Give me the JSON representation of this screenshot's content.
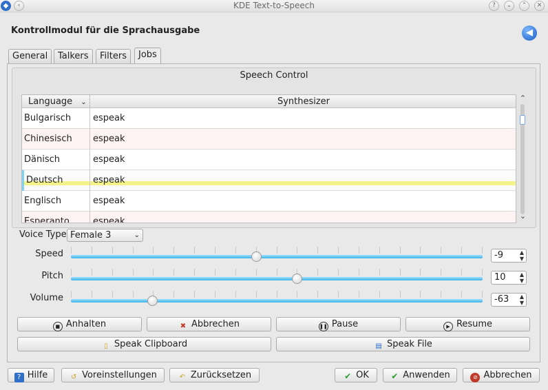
{
  "window": {
    "title": "KDE Text-to-Speech"
  },
  "header": {
    "title": "Kontrollmodul für die Sprachausgabe"
  },
  "tabs": [
    {
      "label": "General"
    },
    {
      "label": "Talkers"
    },
    {
      "label": "Filters"
    },
    {
      "label": "Jobs"
    }
  ],
  "speech_control": {
    "title": "Speech Control",
    "columns": {
      "language": "Language",
      "synthesizer": "Synthesizer"
    },
    "rows": [
      {
        "language": "Bulgarisch",
        "synthesizer": "espeak"
      },
      {
        "language": "Chinesisch",
        "synthesizer": "espeak"
      },
      {
        "language": "Dänisch",
        "synthesizer": "espeak"
      },
      {
        "language": "Deutsch",
        "synthesizer": "espeak"
      },
      {
        "language": "Englisch",
        "synthesizer": "espeak"
      },
      {
        "language": "Esperanto",
        "synthesizer": "espeak"
      }
    ],
    "voice_type_label": "Voice Type",
    "voice_type_value": "Female 3"
  },
  "sliders": {
    "speed": {
      "label": "Speed",
      "value": "-9",
      "fraction": 0.45
    },
    "pitch": {
      "label": "Pitch",
      "value": "10",
      "fraction": 0.55
    },
    "volume": {
      "label": "Volume",
      "value": "-63",
      "fraction": 0.19
    }
  },
  "buttons": {
    "anhalten": "Anhalten",
    "abbrechen": "Abbrechen",
    "pause": "Pause",
    "resume": "Resume",
    "speak_clipboard": "Speak Clipboard",
    "speak_file": "Speak File"
  },
  "footer": {
    "hilfe": "Hilfe",
    "voreinstellungen": "Voreinstellungen",
    "zuruecksetzen": "Zurücksetzen",
    "ok": "OK",
    "anwenden": "Anwenden",
    "abbrechen": "Abbrechen"
  },
  "colors": {
    "accent": "#3cb3e8",
    "selection": "#f3f38a"
  }
}
